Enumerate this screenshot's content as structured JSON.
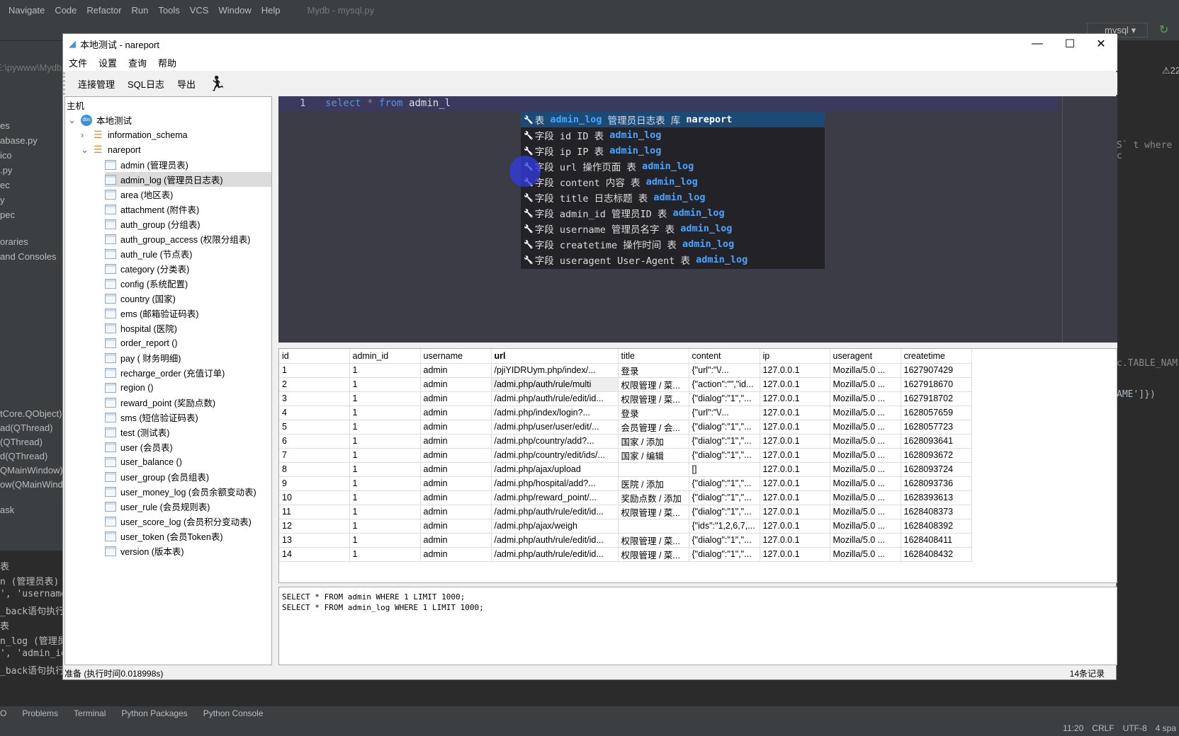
{
  "ide": {
    "menu": [
      "Navigate",
      "Code",
      "Refactor",
      "Run",
      "Tools",
      "VCS",
      "Window",
      "Help"
    ],
    "title": "Mydb - mysql.py",
    "run_config": "mysql",
    "path_fragment": "E:\\pywww\\Mydb",
    "left_fragments": [
      "es",
      "abase.py",
      "ico",
      ".py",
      "ec",
      "y",
      "pec",
      "oraries",
      "and Consoles"
    ],
    "left_fragments2": [
      "tCore.QObject)",
      "ad(QThread)",
      "(QThread)",
      "d(QThread)",
      "QMainWindow)",
      "ow(QMainWind",
      "ask"
    ],
    "console_fragments": [
      "表",
      "n (管理员表)",
      "', 'username",
      "_back语句执行",
      "表",
      "n_log (管理员",
      "', 'admin_id",
      "_back语句执行完成"
    ],
    "right_fragments": [
      "S` t where c",
      "c.TABLE_NAM",
      "AME']})"
    ],
    "warning_count": "22",
    "bottom_tabs": [
      "O",
      "Problems",
      "Terminal",
      "Python Packages",
      "Python Console"
    ],
    "status": [
      "11:20",
      "CRLF",
      "UTF-8",
      "4 spa"
    ]
  },
  "window": {
    "title": "本地测试 - nareport",
    "menu": [
      "文件",
      "设置",
      "查询",
      "帮助"
    ],
    "toolbar": [
      "连接管理",
      "SQL日志",
      "导出"
    ]
  },
  "tree": {
    "root_label": "主机",
    "connection": "本地测试",
    "databases": [
      {
        "name": "information_schema",
        "expanded": false
      },
      {
        "name": "nareport",
        "expanded": true
      }
    ],
    "tables": [
      "admin (管理员表)",
      "admin_log (管理员日志表)",
      "area (地区表)",
      "attachment (附件表)",
      "auth_group (分组表)",
      "auth_group_access (权限分组表)",
      "auth_rule (节点表)",
      "category (分类表)",
      "config (系统配置)",
      "country (国家)",
      "ems (邮箱验证码表)",
      "hospital (医院)",
      "order_report ()",
      "pay ( 财务明细)",
      "recharge_order (充值订单)",
      "region ()",
      "reward_point (奖励点数)",
      "sms (短信验证码表)",
      "test (测试表)",
      "user (会员表)",
      "user_balance ()",
      "user_group (会员组表)",
      "user_money_log (会员余额变动表)",
      "user_rule (会员规则表)",
      "user_score_log (会员积分变动表)",
      "user_token (会员Token表)",
      "version (版本表)"
    ],
    "selected": "admin_log (管理员日志表)"
  },
  "editor": {
    "line_number": "1",
    "kw1": "select",
    "star": "*",
    "kw2": "from",
    "ident": "admin_l",
    "autocomplete": [
      [
        "表 ",
        "admin_log",
        " 管理员日志表 库 ",
        "nareport"
      ],
      [
        "字段 id ID 表 ",
        "admin_log",
        "",
        ""
      ],
      [
        "字段 ip IP 表 ",
        "admin_log",
        "",
        ""
      ],
      [
        "字段 url 操作页面 表 ",
        "admin_log",
        "",
        ""
      ],
      [
        "字段 content 内容 表 ",
        "admin_log",
        "",
        ""
      ],
      [
        "字段 title 日志标题 表 ",
        "admin_log",
        "",
        ""
      ],
      [
        "字段 admin_id 管理员ID 表 ",
        "admin_log",
        "",
        ""
      ],
      [
        "字段 username 管理员名字 表 ",
        "admin_log",
        "",
        ""
      ],
      [
        "字段 createtime 操作时间 表 ",
        "admin_log",
        "",
        ""
      ],
      [
        "字段 useragent User-Agent 表 ",
        "admin_log",
        "",
        ""
      ]
    ]
  },
  "results": {
    "columns": [
      "id",
      "admin_id",
      "username",
      "url",
      "title",
      "content",
      "ip",
      "useragent",
      "createtime"
    ],
    "rows": [
      [
        "1",
        "1",
        "admin",
        "/pjiYIDRUym.php/index/...",
        "登录",
        "{\"url\":\"\\/...",
        "127.0.0.1",
        "Mozilla/5.0 ...",
        "1627907429"
      ],
      [
        "2",
        "1",
        "admin",
        "/admi.php/auth/rule/multi",
        "权限管理 / 菜...",
        "{\"action\":\"\",\"id...",
        "127.0.0.1",
        "Mozilla/5.0 ...",
        "1627918670"
      ],
      [
        "3",
        "1",
        "admin",
        "/admi.php/auth/rule/edit/id...",
        "权限管理 / 菜...",
        "{\"dialog\":\"1\",\"...",
        "127.0.0.1",
        "Mozilla/5.0 ...",
        "1627918702"
      ],
      [
        "4",
        "1",
        "admin",
        "/admi.php/index/login?...",
        "登录",
        "{\"url\":\"\\/...",
        "127.0.0.1",
        "Mozilla/5.0 ...",
        "1628057659"
      ],
      [
        "5",
        "1",
        "admin",
        "/admi.php/user/user/edit/...",
        "会员管理 / 会...",
        "{\"dialog\":\"1\",\"...",
        "127.0.0.1",
        "Mozilla/5.0 ...",
        "1628057723"
      ],
      [
        "6",
        "1",
        "admin",
        "/admi.php/country/add?...",
        "国家 / 添加",
        "{\"dialog\":\"1\",\"...",
        "127.0.0.1",
        "Mozilla/5.0 ...",
        "1628093641"
      ],
      [
        "7",
        "1",
        "admin",
        "/admi.php/country/edit/ids/...",
        "国家 / 编辑",
        "{\"dialog\":\"1\",\"...",
        "127.0.0.1",
        "Mozilla/5.0 ...",
        "1628093672"
      ],
      [
        "8",
        "1",
        "admin",
        "/admi.php/ajax/upload",
        "",
        "[]",
        "127.0.0.1",
        "Mozilla/5.0 ...",
        "1628093724"
      ],
      [
        "9",
        "1",
        "admin",
        "/admi.php/hospital/add?...",
        "医院 / 添加",
        "{\"dialog\":\"1\",\"...",
        "127.0.0.1",
        "Mozilla/5.0 ...",
        "1628093736"
      ],
      [
        "10",
        "1",
        "admin",
        "/admi.php/reward_point/...",
        "奖励点数 / 添加",
        "{\"dialog\":\"1\",\"...",
        "127.0.0.1",
        "Mozilla/5.0 ...",
        "1628393613"
      ],
      [
        "11",
        "1",
        "admin",
        "/admi.php/auth/rule/edit/id...",
        "权限管理 / 菜...",
        "{\"dialog\":\"1\",\"...",
        "127.0.0.1",
        "Mozilla/5.0 ...",
        "1628408373"
      ],
      [
        "12",
        "1",
        "admin",
        "/admi.php/ajax/weigh",
        "",
        "{\"ids\":\"1,2,6,7,...",
        "127.0.0.1",
        "Mozilla/5.0 ...",
        "1628408392"
      ],
      [
        "13",
        "1",
        "admin",
        "/admi.php/auth/rule/edit/id...",
        "权限管理 / 菜...",
        "{\"dialog\":\"1\",\"...",
        "127.0.0.1",
        "Mozilla/5.0 ...",
        "1628408411"
      ],
      [
        "14",
        "1",
        "admin",
        "/admi.php/auth/rule/edit/id...",
        "权限管理 / 菜...",
        "{\"dialog\":\"1\",\"...",
        "127.0.0.1",
        "Mozilla/5.0 ...",
        "1628408432"
      ]
    ]
  },
  "log": [
    "SELECT * FROM admin WHERE 1 LIMIT 1000;",
    "SELECT * FROM admin_log WHERE 1 LIMIT 1000;"
  ],
  "status": {
    "left": "准备 (执行时间0.018998s)",
    "right": "14条记录"
  },
  "colors": {
    "accent_selection": "#1c4a76",
    "table_name_blue": "#4aa3ff",
    "editor_bg": "#3b3c45"
  }
}
